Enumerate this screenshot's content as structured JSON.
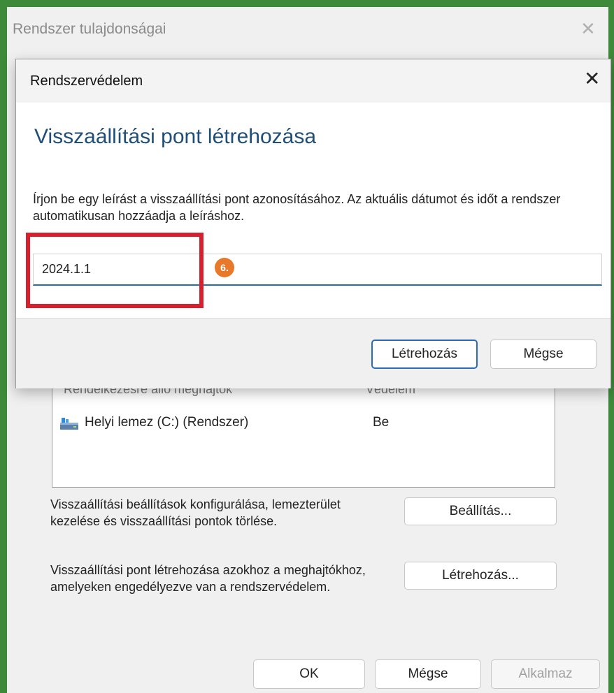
{
  "outer_window": {
    "title": "Rendszer tulajdonságai",
    "close_glyph": "✕"
  },
  "disk_list": {
    "header_name": "Rendelkezésre álló meghajtók",
    "header_protection": "Védelem",
    "rows": [
      {
        "name": "Helyi lemez (C:) (Rendszer)",
        "status": "Be",
        "icon": "drive-icon"
      }
    ]
  },
  "configure": {
    "description": "Visszaállítási beállítások konfigurálása, lemezterület kezelése és visszaállítási pontok törlése.",
    "button_label": "Beállítás..."
  },
  "create": {
    "description": "Visszaállítási pont létrehozása azokhoz a meghajtókhoz, amelyeken engedélyezve van a rendszervédelem.",
    "button_label": "Létrehozás..."
  },
  "bottom_buttons": {
    "ok": "OK",
    "cancel": "Mégse",
    "apply": "Alkalmaz"
  },
  "dialog": {
    "title": "Rendszervédelem",
    "close_glyph": "✕",
    "heading": "Visszaállítási pont létrehozása",
    "instructions": "Írjon be egy leírást a visszaállítási pont azonosításához. Az aktuális dátumot és időt a rendszer automatikusan hozzáadja a leíráshoz.",
    "input_value": "2024.1.1",
    "step_badge": "6.",
    "create_button": "Létrehozás",
    "cancel_button": "Mégse"
  },
  "colors": {
    "heading_blue": "#1f4e79",
    "input_underline": "#2a6bb5",
    "highlight_red": "#d7202e",
    "badge_orange": "#e8782a",
    "frame_green": "#3d8a3a"
  }
}
